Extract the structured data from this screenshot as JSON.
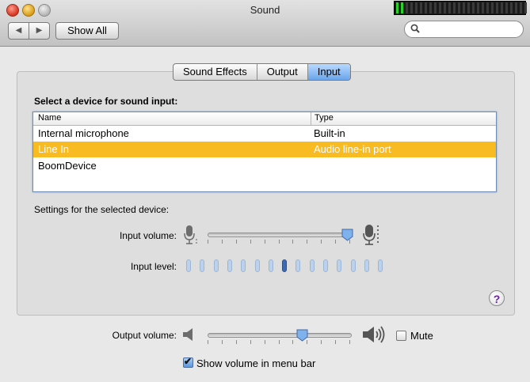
{
  "window": {
    "title": "Sound"
  },
  "toolbar": {
    "back_icon": "◀",
    "forward_icon": "▶",
    "show_all_label": "Show All",
    "search_value": "",
    "search_placeholder": ""
  },
  "meter": {
    "lit_cells": 2,
    "total_cells": 28,
    "lit_color": "#28d428"
  },
  "tabs": [
    {
      "label": "Sound Effects",
      "active": false
    },
    {
      "label": "Output",
      "active": false
    },
    {
      "label": "Input",
      "active": true
    }
  ],
  "input_pane": {
    "section_title": "Select a device for sound input:",
    "table": {
      "columns": [
        "Name",
        "Type"
      ],
      "rows": [
        {
          "name": "Internal microphone",
          "type": "Built-in",
          "selected": false
        },
        {
          "name": "Line In",
          "type": "Audio line-in port",
          "selected": true
        },
        {
          "name": "BoomDevice",
          "type": "",
          "selected": false
        }
      ]
    },
    "settings_label": "Settings for the selected device:",
    "input_volume_label": "Input volume:",
    "input_volume_fraction": 0.98,
    "input_level_label": "Input level:",
    "input_level_bars": 15,
    "input_level_active_index": 7
  },
  "output": {
    "volume_label": "Output volume:",
    "volume_fraction": 0.66,
    "mute_label": "Mute",
    "mute_checked": false,
    "show_volume_label": "Show volume in menu bar",
    "show_volume_checked": true
  },
  "colors": {
    "selected_row": "#f9bb22",
    "tab_active": "#6aa5ec",
    "help_mark": "#6a1fa8"
  },
  "help": {
    "label": "?"
  }
}
